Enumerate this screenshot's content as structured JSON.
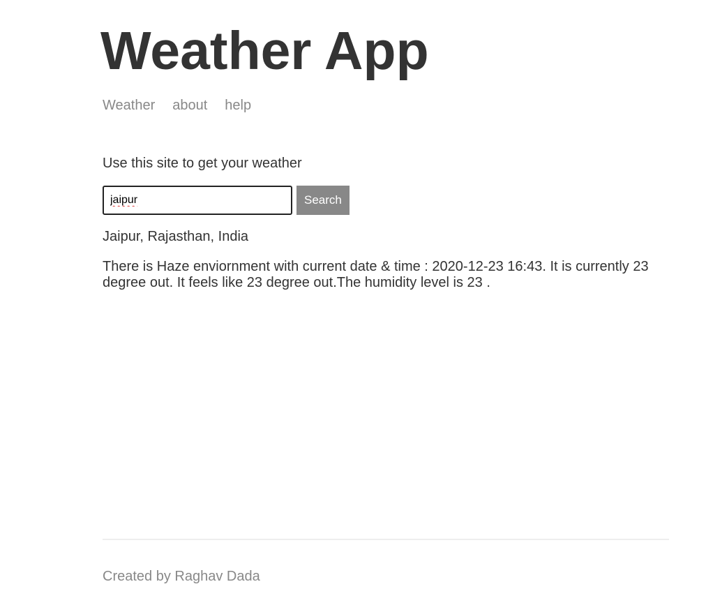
{
  "header": {
    "title": "Weather App",
    "nav": [
      {
        "label": "Weather"
      },
      {
        "label": "about"
      },
      {
        "label": "help"
      }
    ]
  },
  "main": {
    "intro": "Use this site to get your weather",
    "search": {
      "value": "jaipur",
      "button_label": "Search"
    },
    "location": "Jaipur, Rajasthan, India",
    "forecast": "There is Haze enviornment with current date & time : 2020-12-23 16:43. It is currently 23 degree out. It feels like 23 degree out.The humidity level is 23 ."
  },
  "footer": {
    "credit": "Created by Raghav Dada"
  }
}
